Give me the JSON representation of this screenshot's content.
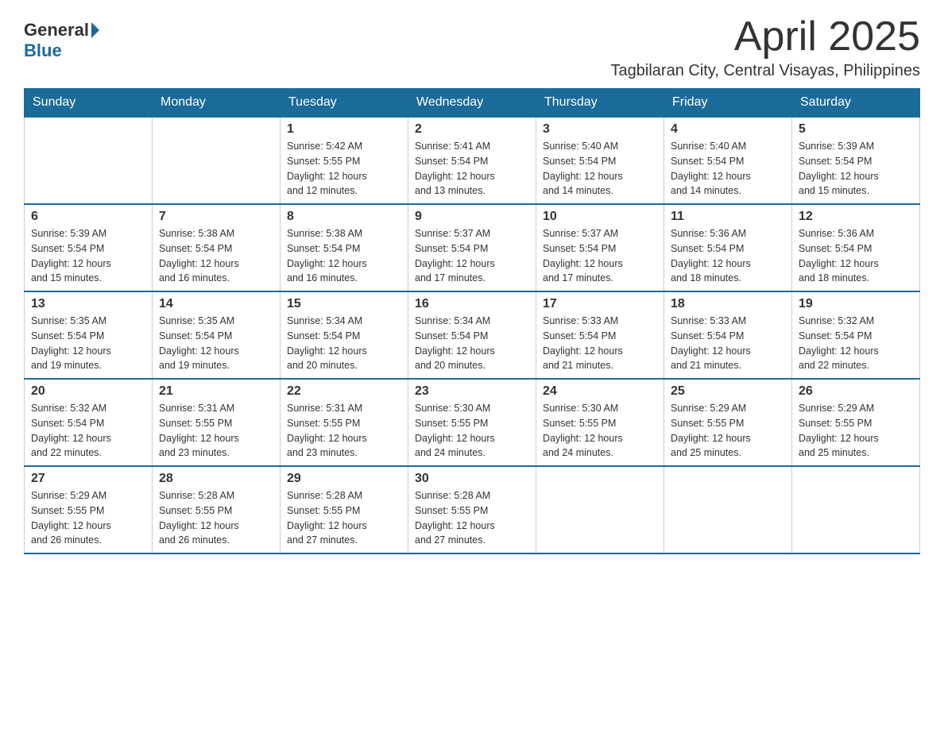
{
  "header": {
    "logo": {
      "part1": "General",
      "part2": "Blue"
    },
    "title": "April 2025",
    "location": "Tagbilaran City, Central Visayas, Philippines"
  },
  "weekdays": [
    "Sunday",
    "Monday",
    "Tuesday",
    "Wednesday",
    "Thursday",
    "Friday",
    "Saturday"
  ],
  "weeks": [
    [
      {
        "day": "",
        "info": ""
      },
      {
        "day": "",
        "info": ""
      },
      {
        "day": "1",
        "info": "Sunrise: 5:42 AM\nSunset: 5:55 PM\nDaylight: 12 hours\nand 12 minutes."
      },
      {
        "day": "2",
        "info": "Sunrise: 5:41 AM\nSunset: 5:54 PM\nDaylight: 12 hours\nand 13 minutes."
      },
      {
        "day": "3",
        "info": "Sunrise: 5:40 AM\nSunset: 5:54 PM\nDaylight: 12 hours\nand 14 minutes."
      },
      {
        "day": "4",
        "info": "Sunrise: 5:40 AM\nSunset: 5:54 PM\nDaylight: 12 hours\nand 14 minutes."
      },
      {
        "day": "5",
        "info": "Sunrise: 5:39 AM\nSunset: 5:54 PM\nDaylight: 12 hours\nand 15 minutes."
      }
    ],
    [
      {
        "day": "6",
        "info": "Sunrise: 5:39 AM\nSunset: 5:54 PM\nDaylight: 12 hours\nand 15 minutes."
      },
      {
        "day": "7",
        "info": "Sunrise: 5:38 AM\nSunset: 5:54 PM\nDaylight: 12 hours\nand 16 minutes."
      },
      {
        "day": "8",
        "info": "Sunrise: 5:38 AM\nSunset: 5:54 PM\nDaylight: 12 hours\nand 16 minutes."
      },
      {
        "day": "9",
        "info": "Sunrise: 5:37 AM\nSunset: 5:54 PM\nDaylight: 12 hours\nand 17 minutes."
      },
      {
        "day": "10",
        "info": "Sunrise: 5:37 AM\nSunset: 5:54 PM\nDaylight: 12 hours\nand 17 minutes."
      },
      {
        "day": "11",
        "info": "Sunrise: 5:36 AM\nSunset: 5:54 PM\nDaylight: 12 hours\nand 18 minutes."
      },
      {
        "day": "12",
        "info": "Sunrise: 5:36 AM\nSunset: 5:54 PM\nDaylight: 12 hours\nand 18 minutes."
      }
    ],
    [
      {
        "day": "13",
        "info": "Sunrise: 5:35 AM\nSunset: 5:54 PM\nDaylight: 12 hours\nand 19 minutes."
      },
      {
        "day": "14",
        "info": "Sunrise: 5:35 AM\nSunset: 5:54 PM\nDaylight: 12 hours\nand 19 minutes."
      },
      {
        "day": "15",
        "info": "Sunrise: 5:34 AM\nSunset: 5:54 PM\nDaylight: 12 hours\nand 20 minutes."
      },
      {
        "day": "16",
        "info": "Sunrise: 5:34 AM\nSunset: 5:54 PM\nDaylight: 12 hours\nand 20 minutes."
      },
      {
        "day": "17",
        "info": "Sunrise: 5:33 AM\nSunset: 5:54 PM\nDaylight: 12 hours\nand 21 minutes."
      },
      {
        "day": "18",
        "info": "Sunrise: 5:33 AM\nSunset: 5:54 PM\nDaylight: 12 hours\nand 21 minutes."
      },
      {
        "day": "19",
        "info": "Sunrise: 5:32 AM\nSunset: 5:54 PM\nDaylight: 12 hours\nand 22 minutes."
      }
    ],
    [
      {
        "day": "20",
        "info": "Sunrise: 5:32 AM\nSunset: 5:54 PM\nDaylight: 12 hours\nand 22 minutes."
      },
      {
        "day": "21",
        "info": "Sunrise: 5:31 AM\nSunset: 5:55 PM\nDaylight: 12 hours\nand 23 minutes."
      },
      {
        "day": "22",
        "info": "Sunrise: 5:31 AM\nSunset: 5:55 PM\nDaylight: 12 hours\nand 23 minutes."
      },
      {
        "day": "23",
        "info": "Sunrise: 5:30 AM\nSunset: 5:55 PM\nDaylight: 12 hours\nand 24 minutes."
      },
      {
        "day": "24",
        "info": "Sunrise: 5:30 AM\nSunset: 5:55 PM\nDaylight: 12 hours\nand 24 minutes."
      },
      {
        "day": "25",
        "info": "Sunrise: 5:29 AM\nSunset: 5:55 PM\nDaylight: 12 hours\nand 25 minutes."
      },
      {
        "day": "26",
        "info": "Sunrise: 5:29 AM\nSunset: 5:55 PM\nDaylight: 12 hours\nand 25 minutes."
      }
    ],
    [
      {
        "day": "27",
        "info": "Sunrise: 5:29 AM\nSunset: 5:55 PM\nDaylight: 12 hours\nand 26 minutes."
      },
      {
        "day": "28",
        "info": "Sunrise: 5:28 AM\nSunset: 5:55 PM\nDaylight: 12 hours\nand 26 minutes."
      },
      {
        "day": "29",
        "info": "Sunrise: 5:28 AM\nSunset: 5:55 PM\nDaylight: 12 hours\nand 27 minutes."
      },
      {
        "day": "30",
        "info": "Sunrise: 5:28 AM\nSunset: 5:55 PM\nDaylight: 12 hours\nand 27 minutes."
      },
      {
        "day": "",
        "info": ""
      },
      {
        "day": "",
        "info": ""
      },
      {
        "day": "",
        "info": ""
      }
    ]
  ]
}
